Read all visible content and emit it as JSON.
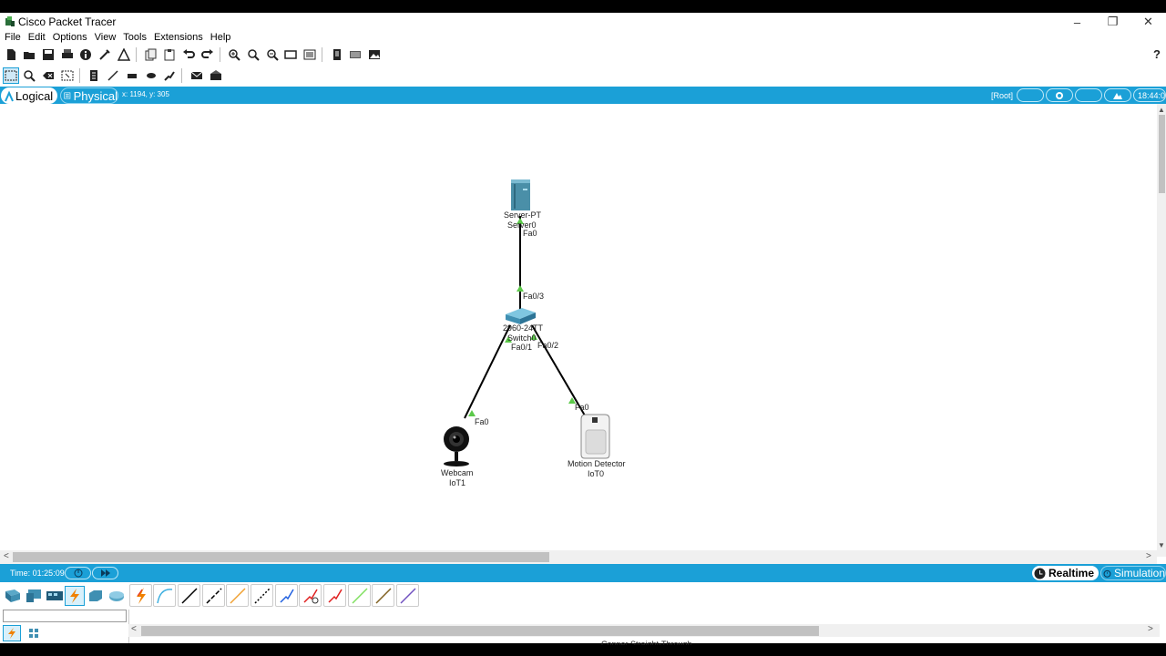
{
  "window": {
    "title": "Cisco Packet Tracer",
    "controls": [
      "–",
      "❐",
      "✕"
    ]
  },
  "menu": [
    "File",
    "Edit",
    "Options",
    "View",
    "Tools",
    "Extensions",
    "Help"
  ],
  "toolbar": {
    "main_icons": [
      "new-file-icon",
      "open-folder-icon",
      "save-icon",
      "print-icon",
      "info-icon",
      "activity-wizard-icon",
      "custom-device-icon",
      "copy-icon",
      "paste-icon",
      "undo-icon",
      "redo-icon",
      "zoom-in-icon",
      "zoom-reset-icon",
      "zoom-out-icon",
      "drawing-palette-icon",
      "custom-devices-dialog-icon",
      "pdu-list-icon",
      "network-info-icon",
      "image-icon"
    ],
    "help_label": "?",
    "tool_icons": [
      "select-icon",
      "inspect-icon",
      "delete-icon",
      "resize-icon",
      "place-note-icon",
      "draw-line-icon",
      "draw-rectangle-icon",
      "draw-ellipse-icon",
      "freeform-icon",
      "add-simple-pdu-icon",
      "add-complex-pdu-icon"
    ]
  },
  "mode_bar": {
    "logical_label": "Logical",
    "physical_label": "Physical",
    "coords": "x: 1194, y: 305",
    "root_label": "[Root]",
    "clock": "18:44:00"
  },
  "topology": {
    "devices": [
      {
        "model": "Server-PT",
        "name": "Server0"
      },
      {
        "model": "2960-24TT",
        "name": "Switch0"
      },
      {
        "model": "Webcam",
        "name": "IoT1"
      },
      {
        "model": "Motion Detector",
        "name": "IoT0"
      }
    ],
    "ports": {
      "server_fa0": "Fa0",
      "switch_fa03": "Fa0/3",
      "switch_fa01": "Fa0/1",
      "switch_fa02": "Fa0/2",
      "webcam_fa0": "Fa0",
      "motion_fa0": "Fa0"
    },
    "link_color": "#000000",
    "port_indicator_color": "#5cc94a"
  },
  "time_bar": {
    "time_label": "Time: 01:25:09",
    "realtime_label": "Realtime",
    "simulation_label": "Simulation"
  },
  "device_panel": {
    "category_icons": [
      "network-devices-icon",
      "end-devices-icon",
      "components-icon",
      "connections-icon",
      "miscellaneous-icon",
      "multiuser-icon"
    ],
    "connection_types": [
      {
        "icon": "automatic-connection-icon",
        "color": "#f08000"
      },
      {
        "icon": "console-cable-icon",
        "color": "#40b0e0"
      },
      {
        "icon": "copper-straight-through-icon",
        "color": "#000000"
      },
      {
        "icon": "copper-cross-over-icon",
        "color": "#000000"
      },
      {
        "icon": "fiber-icon",
        "color": "#f0a030"
      },
      {
        "icon": "phone-cable-icon",
        "color": "#000000"
      },
      {
        "icon": "coaxial-cable-icon",
        "color": "#2060e0"
      },
      {
        "icon": "serial-dce-icon",
        "color": "#e02020"
      },
      {
        "icon": "serial-dte-icon",
        "color": "#e02020"
      },
      {
        "icon": "octal-cable-icon",
        "color": "#80e060"
      },
      {
        "icon": "iot-custom-cable-icon",
        "color": "#806020"
      },
      {
        "icon": "usb-cable-icon",
        "color": "#7050c0"
      }
    ],
    "selected_connection_name": "Copper Straight-Through"
  },
  "colors": {
    "accent": "#1ba0d7"
  }
}
